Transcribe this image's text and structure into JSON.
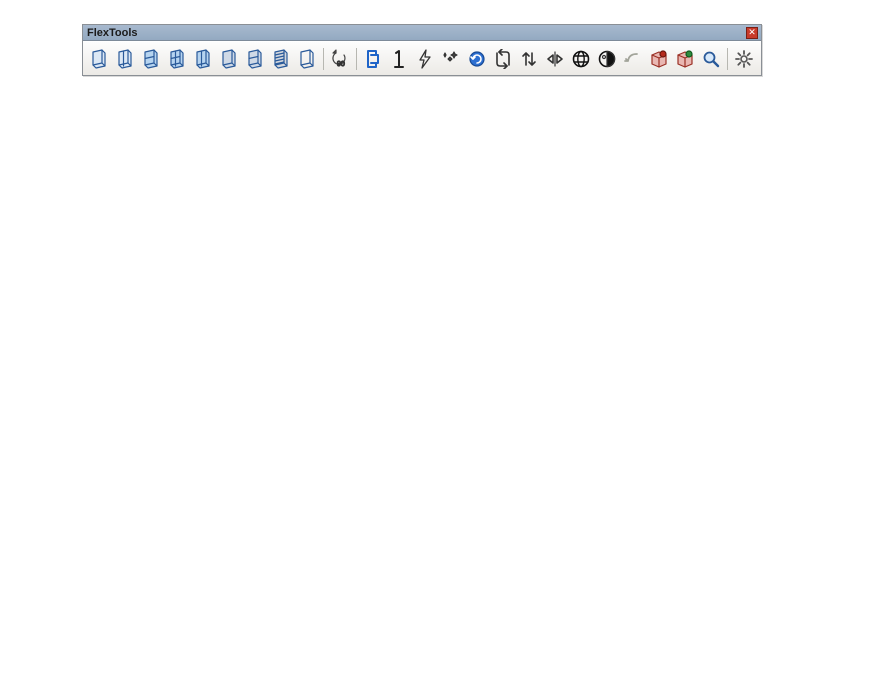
{
  "panel": {
    "title": "FlexTools",
    "close_glyph": "✕"
  },
  "toolbar": {
    "groups": [
      [
        {
          "name": "flexdoor-tool",
          "icon": "door-a"
        },
        {
          "name": "flexdoor-double-tool",
          "icon": "door-b"
        },
        {
          "name": "flexwindow-tool",
          "icon": "window-a"
        },
        {
          "name": "flexwindow-grid-tool",
          "icon": "window-b"
        },
        {
          "name": "flexsliding-tool",
          "icon": "window-c"
        },
        {
          "name": "flexpanel-tool",
          "icon": "panel-a"
        },
        {
          "name": "flexsash-tool",
          "icon": "panel-b"
        },
        {
          "name": "flexslats-tool",
          "icon": "slats"
        },
        {
          "name": "flexframe-tool",
          "icon": "frame"
        }
      ],
      [
        {
          "name": "rotate-90-tool",
          "icon": "rot90"
        }
      ],
      [
        {
          "name": "wall-cutter-tool",
          "icon": "cut-c"
        },
        {
          "name": "instance-one-tool",
          "icon": "one"
        },
        {
          "name": "zap-tool",
          "icon": "bolt"
        },
        {
          "name": "sparkle-tool",
          "icon": "spark"
        },
        {
          "name": "refresh-dynamic-tool",
          "icon": "ref-d"
        },
        {
          "name": "swap-tool",
          "icon": "swap"
        },
        {
          "name": "flip-vertical-tool",
          "icon": "ud-arrows"
        },
        {
          "name": "flip-horizontal-tool",
          "icon": "lr-arrows"
        },
        {
          "name": "globe-tool",
          "icon": "globe"
        },
        {
          "name": "contrast-tool",
          "icon": "contrast"
        },
        {
          "name": "undo-tool",
          "icon": "undo"
        },
        {
          "name": "component-a-tool",
          "icon": "box-r"
        },
        {
          "name": "component-b-tool",
          "icon": "box-g"
        },
        {
          "name": "search-tool",
          "icon": "search"
        }
      ],
      [
        {
          "name": "settings-tool",
          "icon": "gear"
        }
      ]
    ]
  }
}
